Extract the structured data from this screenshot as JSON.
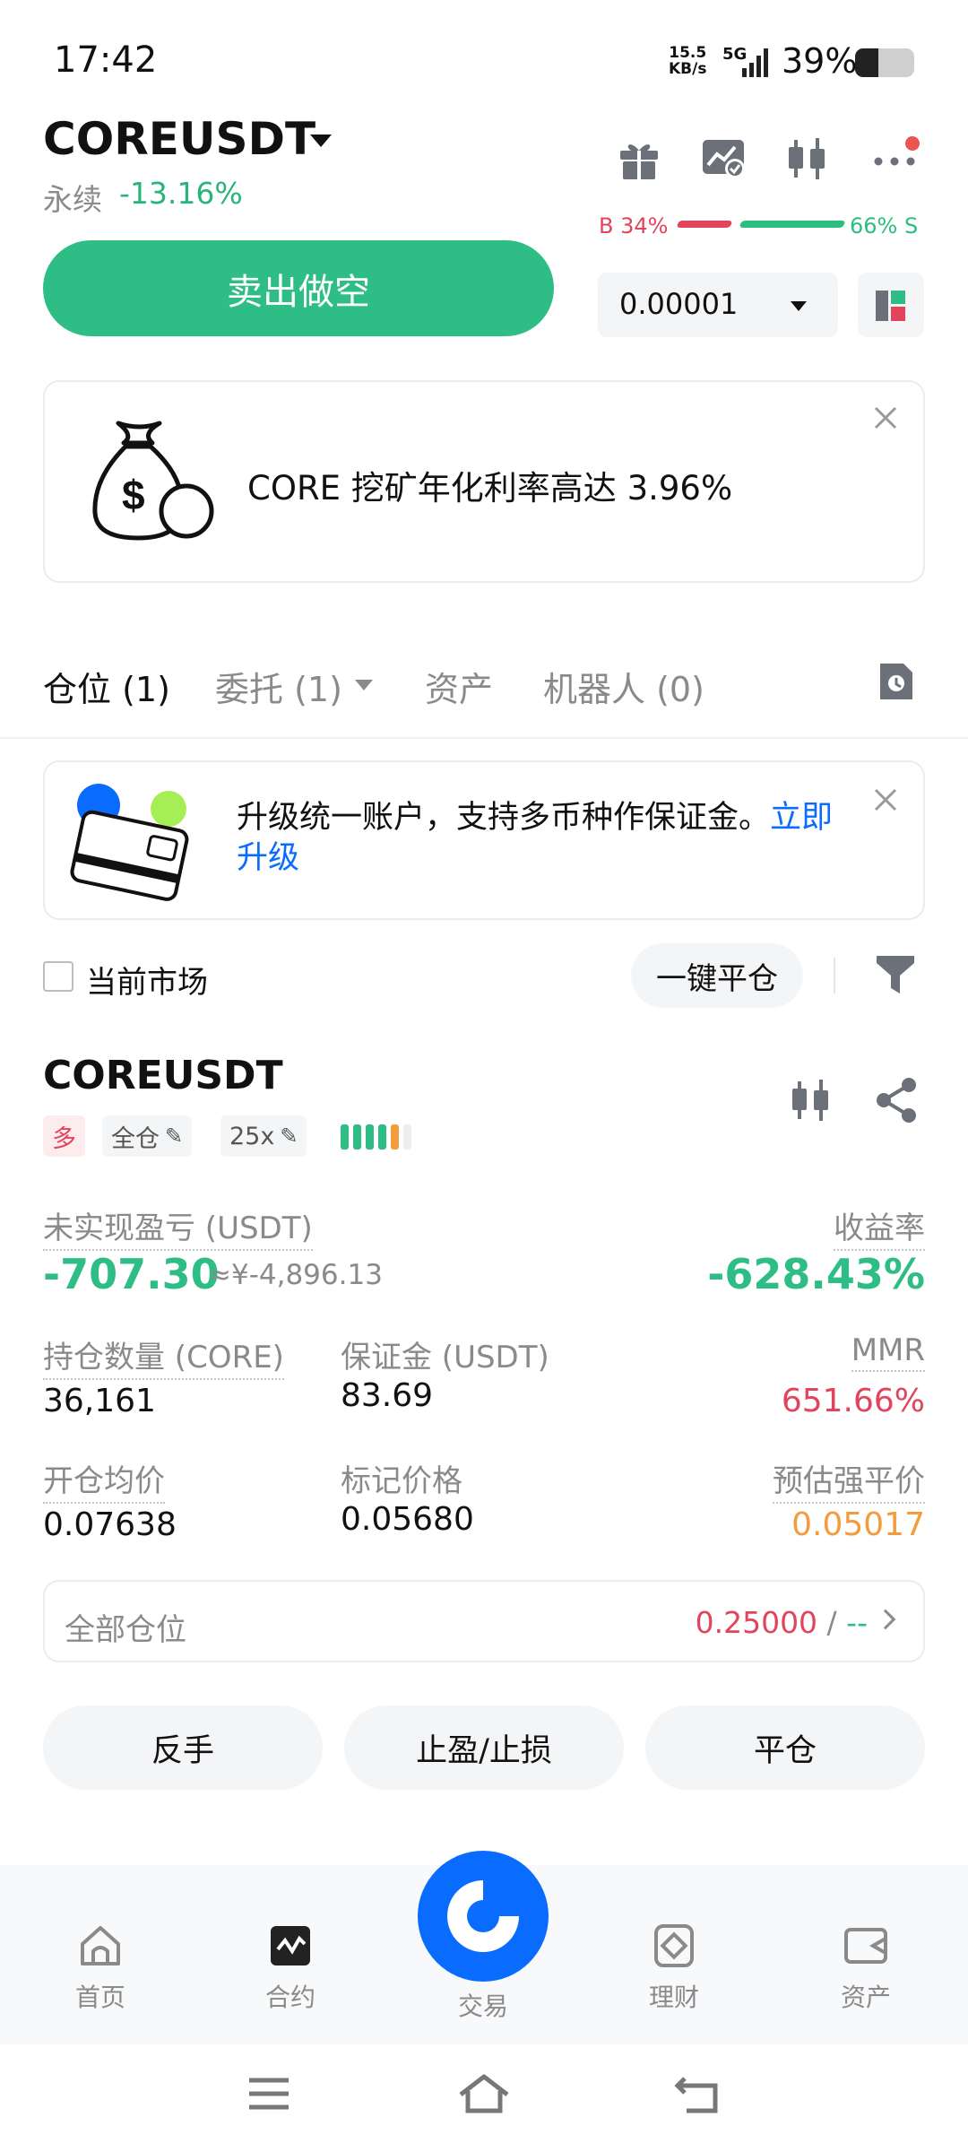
{
  "status_bar": {
    "time": "17:42",
    "net_speed_value": "15.5",
    "net_speed_unit": "KB/s",
    "network": "5G",
    "battery": "39%",
    "battery_level": 0.39
  },
  "header": {
    "pair": "COREUSDT",
    "contract_type": "永续",
    "change": "-13.16%",
    "icons": [
      "gift-icon",
      "chart-check-icon",
      "candlestick-icon",
      "more-icon"
    ]
  },
  "order_ratio": {
    "buy": "B 34%",
    "sell": "66% S"
  },
  "sell_button": "卖出做空",
  "precision": "0.00001",
  "promo": {
    "text": "CORE 挖矿年化利率高达 3.96%"
  },
  "tabs": [
    {
      "label": "仓位 (1)",
      "active": true
    },
    {
      "label": "委托 (1)",
      "active": false
    },
    {
      "label": "资产",
      "active": false
    },
    {
      "label": "机器人 (0)",
      "active": false
    }
  ],
  "upgrade": {
    "text": "升级统一账户，支持多币种作保证金。",
    "link": "立即升级"
  },
  "filters": {
    "current_market": "当前市场",
    "close_all": "一键平仓"
  },
  "position": {
    "symbol": "COREUSDT",
    "side": "多",
    "margin_mode": "全仓",
    "leverage": "25x",
    "unrealized_pnl_label": "未实现盈亏 (USDT)",
    "unrealized_pnl": "-707.30",
    "unrealized_pnl_cny": "≈¥-4,896.13",
    "roe_label": "收益率",
    "roe": "-628.43%",
    "size_label": "持仓数量 (CORE)",
    "size": "36,161",
    "margin_label": "保证金 (USDT)",
    "margin": "83.69",
    "mmr_label": "MMR",
    "mmr": "651.66%",
    "entry_label": "开仓均价",
    "entry": "0.07638",
    "mark_label": "标记价格",
    "mark": "0.05680",
    "liq_label": "预估强平价",
    "liq": "0.05017",
    "colors": {
      "profit": "#2ebd85",
      "loss": "#e2445c",
      "liq": "#f39c3d"
    }
  },
  "all_positions": {
    "label": "全部仓位",
    "value": "0.25000",
    "sep": " / ",
    "tail": "--"
  },
  "actions": [
    "反手",
    "止盈/止损",
    "平仓"
  ],
  "bottom_nav": [
    {
      "label": "首页",
      "icon": "home-icon"
    },
    {
      "label": "合约",
      "icon": "futures-icon",
      "active": true
    },
    {
      "label": "交易",
      "icon": "trade-icon"
    },
    {
      "label": "理财",
      "icon": "earn-icon"
    },
    {
      "label": "资产",
      "icon": "wallet-icon"
    }
  ]
}
